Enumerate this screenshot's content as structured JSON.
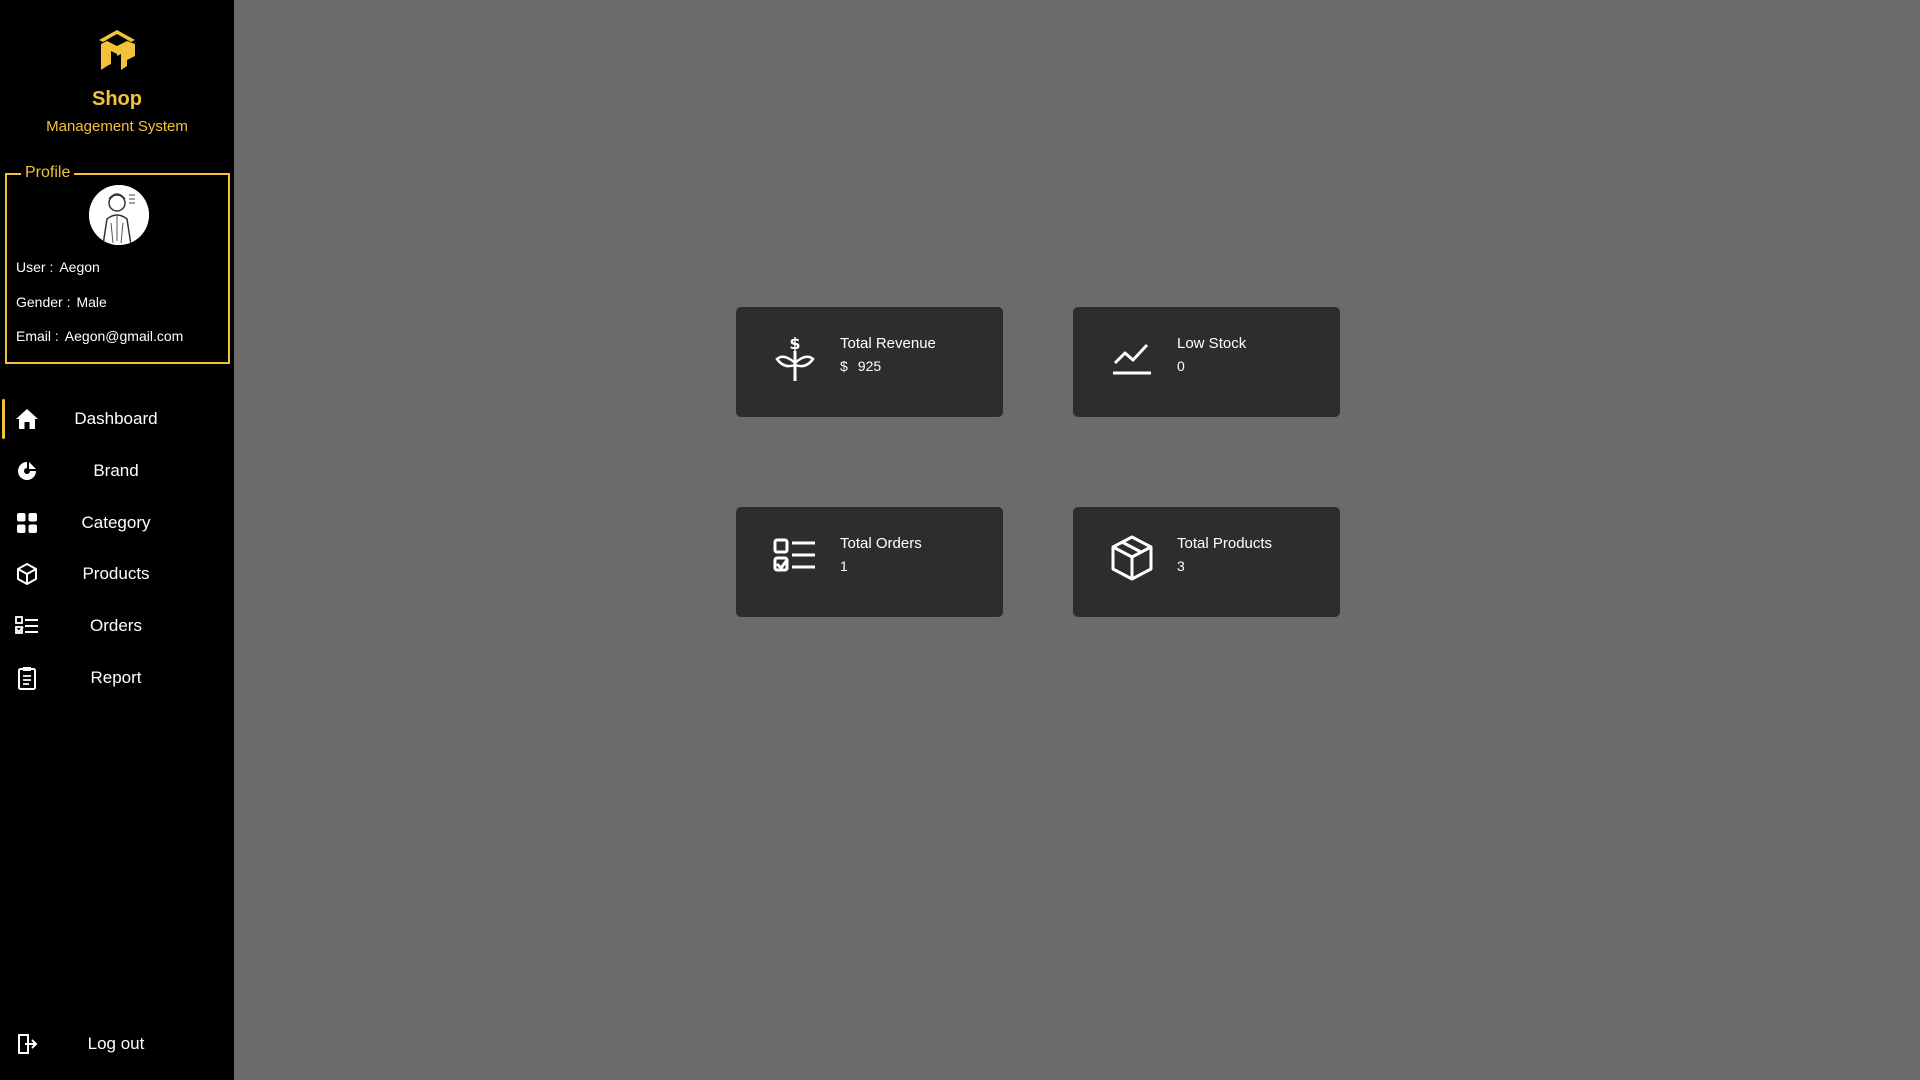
{
  "app": {
    "brand_title": "Shop",
    "brand_subtitle": "Management System",
    "accent_color": "#f3c13a",
    "logo_icon": "shop-logo-icon"
  },
  "profile": {
    "legend": "Profile",
    "avatar_icon": "user-avatar",
    "user_label": "User :",
    "user_value": "Aegon",
    "gender_label": "Gender :",
    "gender_value": "Male",
    "email_label": "Email :",
    "email_value": "Aegon@gmail.com"
  },
  "nav": {
    "items": [
      {
        "label": "Dashboard",
        "icon": "home-icon",
        "active": true
      },
      {
        "label": "Brand",
        "icon": "brand-icon"
      },
      {
        "label": "Category",
        "icon": "grid-icon"
      },
      {
        "label": "Products",
        "icon": "box-icon"
      },
      {
        "label": "Orders",
        "icon": "checklist-icon"
      },
      {
        "label": "Report",
        "icon": "clipboard-icon"
      }
    ],
    "logout_label": "Log out",
    "logout_icon": "logout-icon"
  },
  "cards": [
    {
      "title": "Total Revenue",
      "currency": "$",
      "value": "925",
      "icon": "revenue-plant-icon"
    },
    {
      "title": "Low Stock",
      "value": "0",
      "icon": "trend-chart-icon"
    },
    {
      "title": "Total Orders",
      "value": "1",
      "icon": "checklist-icon"
    },
    {
      "title": "Total Products",
      "value": "3",
      "icon": "box-icon"
    }
  ]
}
